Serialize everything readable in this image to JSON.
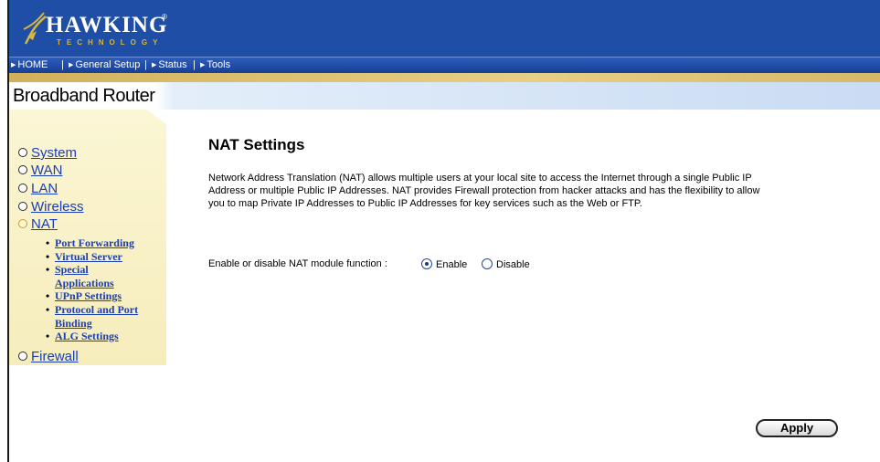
{
  "brand": {
    "name": "HAWKING",
    "sub": "TECHNOLOGY",
    "reg": "®"
  },
  "nav": [
    {
      "label": "HOME"
    },
    {
      "label": "General Setup"
    },
    {
      "label": "Status"
    },
    {
      "label": "Tools"
    }
  ],
  "product_title": "Broadband Router",
  "sidebar": {
    "items": [
      {
        "label": "System"
      },
      {
        "label": "WAN"
      },
      {
        "label": "LAN"
      },
      {
        "label": "Wireless"
      },
      {
        "label": "NAT"
      },
      {
        "label": "Firewall"
      }
    ],
    "nat_sub": [
      {
        "label": "Port Forwarding"
      },
      {
        "label": "Virtual Server"
      },
      {
        "label": "Special"
      },
      {
        "label": "Applications"
      },
      {
        "label": "UPnP Settings"
      },
      {
        "label": "Protocol and Port"
      },
      {
        "label": "Binding"
      },
      {
        "label": "ALG Settings"
      }
    ]
  },
  "main": {
    "title": "NAT Settings",
    "description_lines": [
      "Network Address Translation (NAT) allows multiple users at your local site to access the Internet through a single Public IP",
      "Address or multiple Public IP Addresses. NAT provides Firewall protection from hacker attacks and has the flexibility to allow",
      "you to map Private IP Addresses to Public IP Addresses for key services such as the Web or FTP."
    ],
    "nat_label": "Enable or disable NAT module function :",
    "options": [
      {
        "label": "Enable",
        "checked": true
      },
      {
        "label": "Disable",
        "checked": false
      }
    ],
    "apply": "Apply"
  },
  "colors": {
    "header": "#1f4ea6",
    "sidebar": "#f6edbc",
    "link": "#1b3fb0"
  }
}
